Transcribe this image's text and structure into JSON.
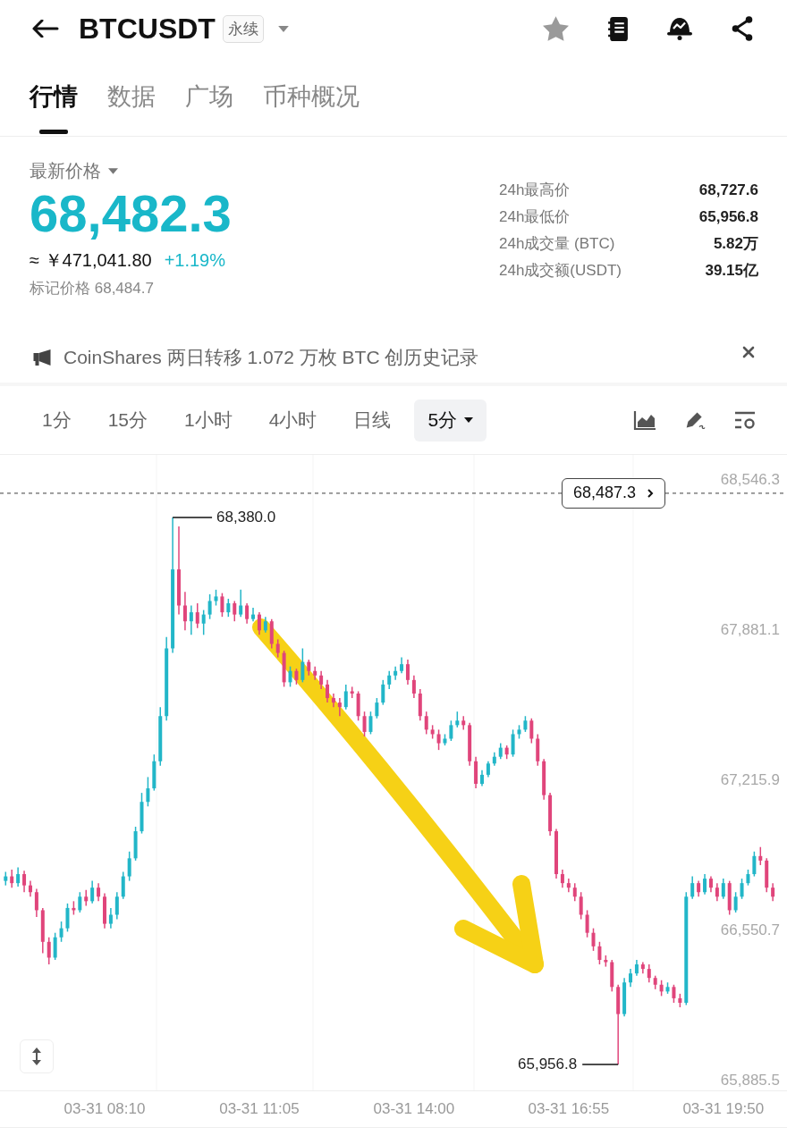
{
  "header": {
    "symbol": "BTCUSDT",
    "badge": "永续",
    "favorited": false
  },
  "tabs": [
    {
      "label": "行情",
      "selected": true
    },
    {
      "label": "数据",
      "selected": false
    },
    {
      "label": "广场",
      "selected": false
    },
    {
      "label": "币种概况",
      "selected": false
    }
  ],
  "quote": {
    "label": "最新价格",
    "last_price": "68,482.3",
    "approx_cny": "≈ ￥471,041.80",
    "change": "+1.19%",
    "mark_price": "标记价格 68,484.7"
  },
  "stats": [
    {
      "label": "24h最高价",
      "value": "68,727.6"
    },
    {
      "label": "24h最低价",
      "value": "65,956.8"
    },
    {
      "label": "24h成交量 (BTC)",
      "value": "5.82万"
    },
    {
      "label": "24h成交额(USDT)",
      "value": "39.15亿"
    }
  ],
  "notice": {
    "text": "CoinShares 两日转移 1.072 万枚 BTC 创历史记录"
  },
  "intervals": [
    {
      "label": "1分",
      "kind": "option",
      "selected": false
    },
    {
      "label": "15分",
      "kind": "option",
      "selected": false
    },
    {
      "label": "1小时",
      "kind": "option",
      "selected": false
    },
    {
      "label": "4小时",
      "kind": "option",
      "selected": false
    },
    {
      "label": "日线",
      "kind": "option",
      "selected": false
    },
    {
      "label": "5分",
      "kind": "menu",
      "selected": true
    }
  ],
  "chart": {
    "chart_data": {
      "type": "candlestick",
      "categories": [
        null,
        null,
        null,
        null,
        null,
        null,
        null,
        null,
        null,
        null,
        null,
        null,
        null,
        null,
        null,
        null,
        "03-31 08:10",
        null,
        null,
        null,
        null,
        null,
        null,
        null,
        null,
        null,
        null,
        null,
        null,
        null,
        null,
        null,
        null,
        null,
        null,
        null,
        null,
        null,
        null,
        null,
        null,
        "03-31 11:05",
        null,
        null,
        null,
        null,
        null,
        null,
        null,
        null,
        null,
        null,
        null,
        null,
        null,
        null,
        null,
        null,
        null,
        null,
        null,
        null,
        null,
        null,
        null,
        null,
        "03-31 14:00",
        null,
        null,
        null,
        null,
        null,
        null,
        null,
        null,
        null,
        null,
        null,
        null,
        null,
        null,
        null,
        null,
        null,
        null,
        null,
        null,
        null,
        null,
        null,
        null,
        "03-31 16:55",
        null,
        null,
        null,
        null,
        null,
        null,
        null,
        null,
        null,
        null,
        null,
        null,
        null,
        null,
        null,
        null,
        null,
        null,
        null,
        null,
        null,
        null,
        null,
        null,
        "03-31 19:50",
        null,
        null,
        null,
        null,
        null,
        null,
        null,
        null
      ],
      "ohlc": [
        [
          66770,
          66810,
          66750,
          66790
        ],
        [
          66790,
          66820,
          66740,
          66760
        ],
        [
          66760,
          66830,
          66745,
          66800
        ],
        [
          66800,
          66815,
          66720,
          66750
        ],
        [
          66750,
          66770,
          66700,
          66720
        ],
        [
          66720,
          66735,
          66610,
          66640
        ],
        [
          66640,
          66650,
          66450,
          66500
        ],
        [
          66500,
          66520,
          66400,
          66430
        ],
        [
          66430,
          66540,
          66420,
          66520
        ],
        [
          66520,
          66590,
          66500,
          66560
        ],
        [
          66560,
          66670,
          66545,
          66650
        ],
        [
          66650,
          66680,
          66620,
          66640
        ],
        [
          66640,
          66720,
          66630,
          66700
        ],
        [
          66700,
          66730,
          66660,
          66680
        ],
        [
          66680,
          66770,
          66670,
          66740
        ],
        [
          66740,
          66760,
          66680,
          66700
        ],
        [
          66700,
          66715,
          66560,
          66580
        ],
        [
          66580,
          66650,
          66560,
          66620
        ],
        [
          66620,
          66720,
          66600,
          66700
        ],
        [
          66700,
          66810,
          66690,
          66790
        ],
        [
          66790,
          66900,
          66770,
          66870
        ],
        [
          66870,
          67010,
          66860,
          66990
        ],
        [
          66990,
          67160,
          66980,
          67120
        ],
        [
          67120,
          67230,
          67100,
          67180
        ],
        [
          67180,
          67330,
          67170,
          67300
        ],
        [
          67300,
          67540,
          67280,
          67500
        ],
        [
          67500,
          67850,
          67480,
          67800
        ],
        [
          67800,
          68380,
          67780,
          68150
        ],
        [
          68150,
          68340,
          67950,
          67990
        ],
        [
          67990,
          68050,
          67880,
          67920
        ],
        [
          67920,
          67990,
          67860,
          67960
        ],
        [
          67960,
          68000,
          67890,
          67910
        ],
        [
          67910,
          67970,
          67860,
          67950
        ],
        [
          67950,
          68040,
          67930,
          68010
        ],
        [
          68010,
          68060,
          67990,
          68030
        ],
        [
          68030,
          68045,
          67940,
          67960
        ],
        [
          67960,
          68020,
          67940,
          68000
        ],
        [
          68000,
          68010,
          67920,
          67950
        ],
        [
          67950,
          68060,
          67940,
          67990
        ],
        [
          67990,
          68000,
          67910,
          67930
        ],
        [
          67930,
          67980,
          67920,
          67950
        ],
        [
          67950,
          67960,
          67860,
          67880
        ],
        [
          67880,
          67940,
          67870,
          67920
        ],
        [
          67920,
          67930,
          67800,
          67820
        ],
        [
          67820,
          67840,
          67760,
          67780
        ],
        [
          67780,
          67790,
          67630,
          67650
        ],
        [
          67650,
          67720,
          67630,
          67700
        ],
        [
          67700,
          67710,
          67640,
          67660
        ],
        [
          67660,
          67800,
          67650,
          67740
        ],
        [
          67740,
          67750,
          67680,
          67700
        ],
        [
          67700,
          67720,
          67660,
          67680
        ],
        [
          67680,
          67700,
          67620,
          67640
        ],
        [
          67640,
          67660,
          67560,
          67580
        ],
        [
          67580,
          67600,
          67540,
          67560
        ],
        [
          67560,
          67580,
          67500,
          67540
        ],
        [
          67540,
          67640,
          67530,
          67610
        ],
        [
          67610,
          67630,
          67580,
          67600
        ],
        [
          67600,
          67610,
          67480,
          67500
        ],
        [
          67500,
          67520,
          67410,
          67430
        ],
        [
          67430,
          67520,
          67420,
          67500
        ],
        [
          67500,
          67580,
          67490,
          67560
        ],
        [
          67560,
          67660,
          67550,
          67640
        ],
        [
          67640,
          67700,
          67620,
          67680
        ],
        [
          67680,
          67720,
          67660,
          67700
        ],
        [
          67700,
          67760,
          67690,
          67730
        ],
        [
          67730,
          67750,
          67640,
          67660
        ],
        [
          67660,
          67680,
          67580,
          67600
        ],
        [
          67600,
          67620,
          67480,
          67500
        ],
        [
          67500,
          67520,
          67420,
          67440
        ],
        [
          67440,
          67460,
          67400,
          67420
        ],
        [
          67420,
          67440,
          67350,
          67380
        ],
        [
          67380,
          67420,
          67370,
          67400
        ],
        [
          67400,
          67480,
          67390,
          67460
        ],
        [
          67460,
          67520,
          67450,
          67480
        ],
        [
          67480,
          67500,
          67440,
          67460
        ],
        [
          67460,
          67470,
          67280,
          67300
        ],
        [
          67300,
          67320,
          67180,
          67200
        ],
        [
          67200,
          67260,
          67190,
          67240
        ],
        [
          67240,
          67300,
          67230,
          67290
        ],
        [
          67290,
          67340,
          67280,
          67320
        ],
        [
          67320,
          67380,
          67310,
          67360
        ],
        [
          67360,
          67370,
          67310,
          67330
        ],
        [
          67330,
          67440,
          67320,
          67420
        ],
        [
          67420,
          67460,
          67400,
          67440
        ],
        [
          67440,
          67500,
          67430,
          67480
        ],
        [
          67480,
          67490,
          67380,
          67400
        ],
        [
          67400,
          67420,
          67280,
          67300
        ],
        [
          67300,
          67310,
          67130,
          67150
        ],
        [
          67150,
          67160,
          66970,
          66990
        ],
        [
          66990,
          67000,
          66780,
          66800
        ],
        [
          66800,
          66820,
          66740,
          66760
        ],
        [
          66760,
          66780,
          66720,
          66740
        ],
        [
          66740,
          66760,
          66680,
          66700
        ],
        [
          66700,
          66720,
          66600,
          66620
        ],
        [
          66620,
          66640,
          66520,
          66540
        ],
        [
          66540,
          66560,
          66460,
          66480
        ],
        [
          66480,
          66500,
          66400,
          66420
        ],
        [
          66420,
          66440,
          66390,
          66410
        ],
        [
          66410,
          66420,
          66280,
          66300
        ],
        [
          66300,
          66310,
          65956.8,
          66180
        ],
        [
          66180,
          66340,
          66170,
          66320
        ],
        [
          66320,
          66380,
          66300,
          66360
        ],
        [
          66360,
          66420,
          66350,
          66400
        ],
        [
          66400,
          66410,
          66360,
          66380
        ],
        [
          66380,
          66400,
          66320,
          66340
        ],
        [
          66340,
          66350,
          66290,
          66310
        ],
        [
          66310,
          66330,
          66260,
          66280
        ],
        [
          66280,
          66320,
          66270,
          66300
        ],
        [
          66300,
          66310,
          66230,
          66250
        ],
        [
          66250,
          66270,
          66210,
          66230
        ],
        [
          66230,
          66720,
          66220,
          66700
        ],
        [
          66700,
          66790,
          66690,
          66760
        ],
        [
          66760,
          66770,
          66700,
          66720
        ],
        [
          66720,
          66800,
          66710,
          66780
        ],
        [
          66780,
          66790,
          66720,
          66740
        ],
        [
          66740,
          66760,
          66680,
          66700
        ],
        [
          66700,
          66780,
          66690,
          66760
        ],
        [
          66760,
          66770,
          66620,
          66640
        ],
        [
          66640,
          66720,
          66630,
          66700
        ],
        [
          66700,
          66780,
          66690,
          66760
        ],
        [
          66760,
          66820,
          66750,
          66800
        ],
        [
          66800,
          66900,
          66790,
          66880
        ],
        [
          66880,
          66920,
          66840,
          66860
        ],
        [
          66860,
          66870,
          66720,
          66740
        ],
        [
          66740,
          66760,
          66680,
          66700
        ]
      ],
      "ylim": [
        65841.9,
        68657.2
      ],
      "yticks": [
        {
          "value": 68546.3,
          "label": "68,546.3"
        },
        {
          "value": 67881.1,
          "label": "67,881.1"
        },
        {
          "value": 67215.9,
          "label": "67,215.9"
        },
        {
          "value": 66550.7,
          "label": "66,550.7"
        },
        {
          "value": 65885.5,
          "label": "65,885.5"
        }
      ],
      "ref_lines": [
        {
          "axis": "y",
          "value": 68487.3,
          "label": "68,487.3"
        }
      ],
      "annotations": [
        "68,380.0",
        "65,956.8"
      ]
    }
  }
}
